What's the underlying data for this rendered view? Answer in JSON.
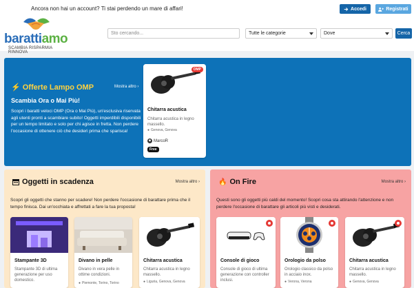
{
  "header": {
    "promo": "Ancora non hai un account? Ti stai perdendo un mare di affari!",
    "login_label": "Accedi",
    "register_label": "Registrati",
    "logo_part1": "baratti",
    "logo_part2": "amo",
    "tagline": "SCAMBIA RISPARMIA RINNOVA",
    "search_placeholder": "Sto cercando...",
    "category_selected": "Tutte le categorie",
    "where_selected": "Dove",
    "search_button": "Cerca"
  },
  "lampo": {
    "title": "Offerte Lampo OMP",
    "more": "Mostra altro",
    "subtitle": "Scambia Ora o Mai Più!",
    "description": "Scopri i baratti veloci OMP (Ora o Mai Più), un'esclusiva riservata agli utenti pronti a scambiare subito! Oggetti imperdibili disponibili per un tempo limitato e solo per chi agisce in fretta. Non perdere l'occasione di ottenere ciò che desideri prima che sparisca!",
    "card": {
      "badge": "OMP",
      "title": "Chitarra acustica",
      "desc": "Chitarra acustica in legno massello.",
      "location": "Genova, Genova",
      "user": "MarcoR",
      "tag": "Free"
    }
  },
  "scadenza": {
    "title": "Oggetti in scadenza",
    "more": "Mostra altro",
    "description": "Scopri gli oggetti che stanno per scadere! Non perdere l'occasione di barattare prima che il tempo finisca. Dai un'occhiata e affrettati a fare la tua proposta!",
    "items": [
      {
        "title": "Stampante 3D",
        "desc": "Stampante 3D di ultima generazione per uso domestico.",
        "location": ""
      },
      {
        "title": "Divano in pelle",
        "desc": "Divano in vera pelle in ottime condizioni.",
        "location": "Piemonte, Torino, Torino"
      },
      {
        "title": "Chitarra acustica",
        "desc": "Chitarra acustica in legno massello.",
        "location": "Liguria, Genova, Genova"
      }
    ]
  },
  "onfire": {
    "title": "On Fire",
    "more": "Mostra altro",
    "description": "Questi sono gli oggetti più caldi del momento! Scopri cosa sta attirando l'attenzione e non perdere l'occasione di barattare gli articoli più visti e desiderati.",
    "items": [
      {
        "title": "Console di gioco",
        "desc": "Console di gioco di ultima generazione con controller inclusi.",
        "location": ""
      },
      {
        "title": "Orologio da polso",
        "desc": "Orologio classico da polso in acciaio inox.",
        "location": "Verona, Verona"
      },
      {
        "title": "Chitarra acustica",
        "desc": "Chitarra acustica in legno massello.",
        "location": "Genova, Genova"
      }
    ]
  },
  "colors": {
    "primary": "#1565a8",
    "lampo_bg": "#0d72b8",
    "scadenza_bg": "#fde8c8",
    "fire_bg": "#f7a3a3",
    "accent_yellow": "#ffd23f"
  }
}
